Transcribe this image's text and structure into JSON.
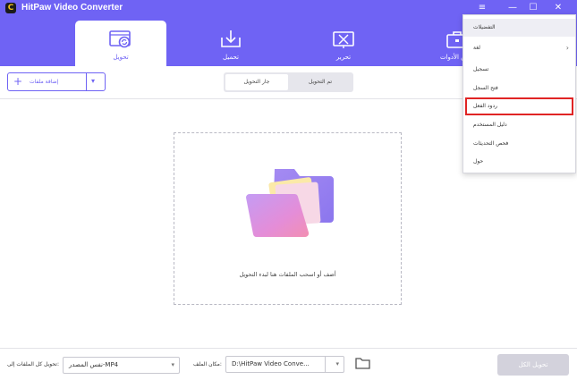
{
  "app": {
    "title": "HitPaw Video Converter",
    "logo_letter": "C",
    "colors": {
      "accent": "#6f63f4",
      "highlight": "#e02424",
      "disabled": "#d3d2dc"
    }
  },
  "window_controls": {
    "menu_icon": "≡",
    "minimize_icon": "—",
    "maximize_icon": "☐",
    "close_icon": "✕"
  },
  "tabs": [
    {
      "label": "تحويل",
      "icon": "convert-icon",
      "active": true
    },
    {
      "label": "تحميل",
      "icon": "download-icon",
      "active": false
    },
    {
      "label": "تحرير",
      "icon": "edit-icon",
      "active": false
    },
    {
      "label": "ق الأدوات",
      "icon": "toolbox-icon",
      "active": false
    }
  ],
  "toolbar": {
    "add_files_label": "إضافة ملفات",
    "add_icon": "+",
    "dropdown_icon": "▾",
    "segment": {
      "converting": "جار التحويل",
      "converted": "تم التحويل"
    }
  },
  "dropzone": {
    "hint": "أضف أو اسحب الملفات هنا لبدء التحويل"
  },
  "footer": {
    "convert_all_to_label": "تحويل كل الملفات إلى:",
    "format_value": "نفس المصدر-MP4",
    "save_to_label": "مكان الملف:",
    "save_path_value": "D:\\HitPaw Video Conve...",
    "select_arrow": "▾",
    "convert_all_button": "تحويل الكل"
  },
  "menu": {
    "items": [
      "التفضيلات",
      "لغة",
      "تسجيل",
      "فتح السجل",
      "ردود الفعل",
      "دليل المستخدم",
      "فحص التحديثات",
      "حول"
    ],
    "submenu_arrow": "›",
    "highlighted": "ردود الفعل"
  }
}
